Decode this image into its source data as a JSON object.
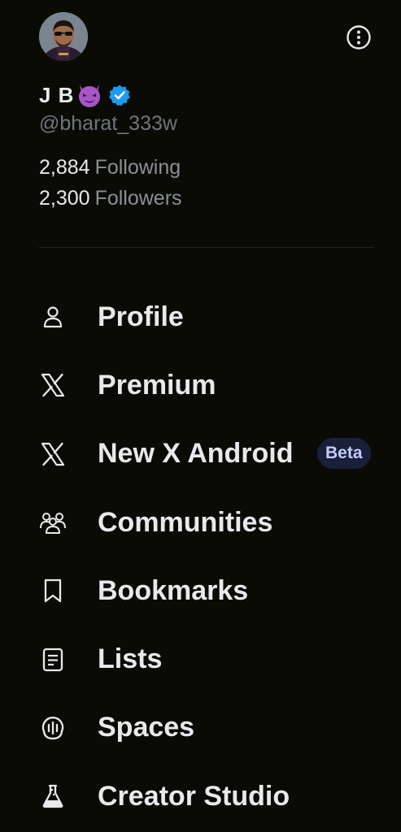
{
  "profile": {
    "display_name": "J B",
    "handle": "@bharat_333w",
    "following_count": "2,884",
    "following_label": "Following",
    "followers_count": "2,300",
    "followers_label": "Followers"
  },
  "menu": {
    "items": [
      {
        "label": "Profile",
        "icon": "person-icon"
      },
      {
        "label": "Premium",
        "icon": "x-logo-icon"
      },
      {
        "label": "New X Android",
        "icon": "x-logo-icon",
        "badge": "Beta"
      },
      {
        "label": "Communities",
        "icon": "communities-icon"
      },
      {
        "label": "Bookmarks",
        "icon": "bookmark-icon"
      },
      {
        "label": "Lists",
        "icon": "list-icon"
      },
      {
        "label": "Spaces",
        "icon": "spaces-icon"
      },
      {
        "label": "Creator Studio",
        "icon": "flask-icon"
      }
    ]
  },
  "colors": {
    "background": "#0b0b06",
    "text_primary": "#e7e9ea",
    "text_secondary": "#71767b",
    "verified_blue": "#1d9bf0",
    "beta_badge_bg": "#1a1f3a",
    "beta_badge_text": "#c4ccf8"
  }
}
